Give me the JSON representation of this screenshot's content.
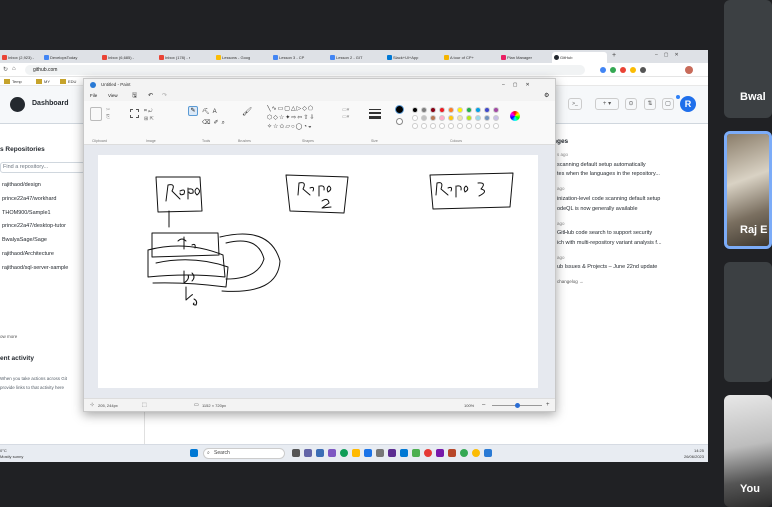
{
  "browser": {
    "tabs": [
      "Inbox (2,923) -",
      "DevelopsToday",
      "Inbox (6,685) -",
      "Inbox (178) - r",
      "Lessons - Goog",
      "Lesson 3 - CP",
      "Lesson 2 - GIT",
      "Slack+Ul+App",
      "A tour of CP+",
      "Plan Manager",
      "GitHub"
    ],
    "url": "github.com",
    "bookmarks": [
      "Temp",
      "MY",
      "EDU"
    ]
  },
  "github": {
    "title": "Dashboard",
    "repos_heading": "s Repositories",
    "find_placeholder": "Find a repository...",
    "repos": [
      "rajithaod/design",
      "prince22a47/workhard",
      "THOM900/Sample1",
      "prince22a47/desktop-tutor",
      "BwalyaSage/Sage",
      "rajithaod/Architecture",
      "rajithaod/sql-server-sample"
    ],
    "show_more": "ow more",
    "activity_heading": "ent activity",
    "activity_text": [
      "When you take actions across Git",
      "provide links to that activity here"
    ],
    "changes_heading": "nges",
    "changes": [
      {
        "time": "s ago",
        "lines": [
          "scanning default setup automatically",
          "tes when the languages in the repository..."
        ]
      },
      {
        "time": "ago",
        "lines": [
          "inization-level code scanning default setup",
          "odeQL is now generally available"
        ]
      },
      {
        "time": "ago",
        "lines": [
          "GitHub code search to support security",
          "ich with multi-repository variant analysis f..."
        ]
      },
      {
        "time": "ago",
        "lines": [
          "ub Issues & Projects – June 22nd update"
        ]
      }
    ],
    "changelog": "changelog →"
  },
  "paint": {
    "title": "Untitled - Paint",
    "menu": [
      "File",
      "View"
    ],
    "groups": [
      "Clipboard",
      "Image",
      "Tools",
      "Brushes",
      "Shapes",
      "Size",
      "Colours"
    ],
    "status_pos": "205, 244px",
    "status_size": "1152 × 720px",
    "zoom": "100%",
    "drawing_labels": [
      "Repo",
      "Repo 2",
      "Repo 3"
    ],
    "palette": [
      "#000000",
      "#7f7f7f",
      "#880015",
      "#ed1c24",
      "#ff7f27",
      "#fff200",
      "#22b14c",
      "#00a2e8",
      "#3f48cc",
      "#a349a4",
      "#ffffff",
      "#c3c3c3",
      "#b97a57",
      "#ffaec9",
      "#ffc90e",
      "#efe4b0",
      "#b5e61d",
      "#99d9ea",
      "#7092be",
      "#c8bfe7"
    ]
  },
  "taskbar": {
    "weather": [
      "0°C",
      "Mostly sunny"
    ],
    "search": "Search",
    "time": "14:25",
    "date": "26/06/2023"
  },
  "participants": [
    "Bwal",
    "Raj E",
    "You"
  ]
}
